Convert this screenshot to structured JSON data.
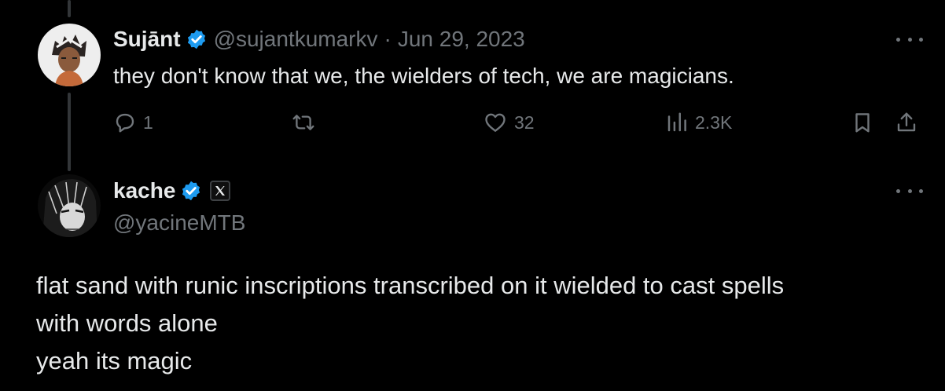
{
  "reply": {
    "display_name": "Sujānt",
    "handle": "@sujantkumarkv",
    "separator": "·",
    "date": "Jun 29, 2023",
    "text": "they don't know that we, the wielders of tech, we are magicians.",
    "actions": {
      "replies": "1",
      "likes": "32",
      "views": "2.3K"
    }
  },
  "quoted": {
    "display_name": "kache",
    "handle": "@yacineMTB",
    "body_lines": [
      "flat sand with runic inscriptions transcribed on it wielded to cast spells",
      "with words alone",
      "yeah its magic"
    ]
  },
  "colors": {
    "background": "#000000",
    "text_primary": "#e7e9ea",
    "text_secondary": "#71767b",
    "verified_blue": "#1d9bf0"
  },
  "icons": {
    "reply": "speech-bubble-icon",
    "retweet": "repost-arrows-icon",
    "like": "heart-icon",
    "views": "bar-chart-icon",
    "bookmark": "bookmark-icon",
    "share": "share-upload-icon",
    "verified": "verified-badge-icon",
    "x_badge": "x-logo-icon",
    "more": "more-dots-icon"
  }
}
